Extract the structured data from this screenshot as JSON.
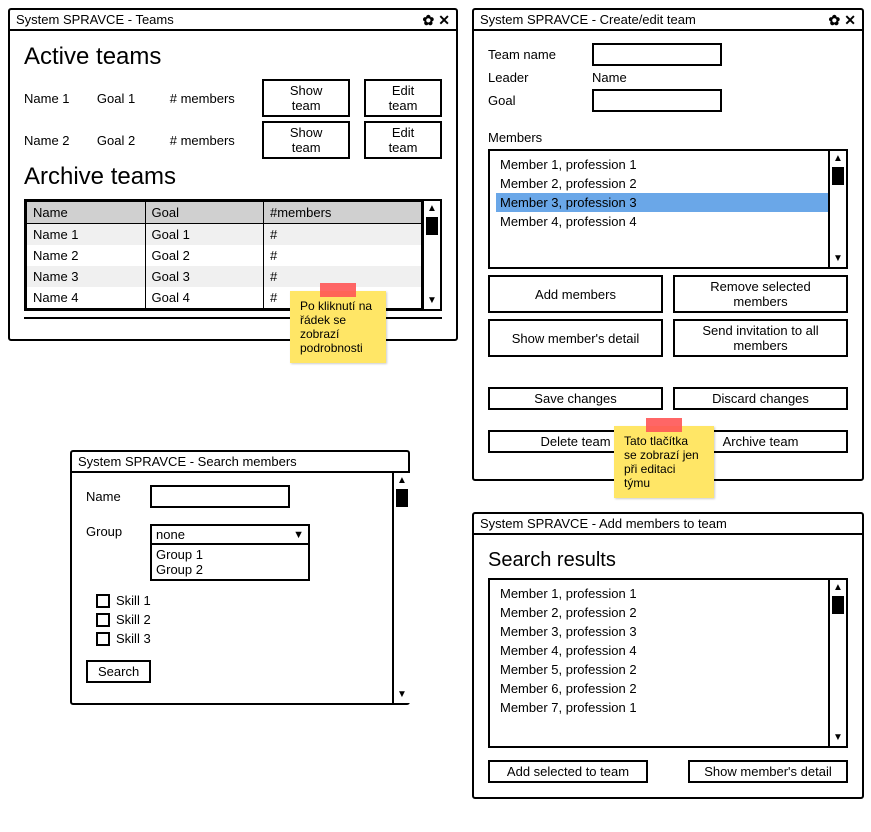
{
  "teams_window": {
    "title": "System SPRAVCE - Teams",
    "heading_active": "Active teams",
    "heading_archive": "Archive teams",
    "active": [
      {
        "name": "Name 1",
        "goal": "Goal 1",
        "members": "# members",
        "show": "Show team",
        "edit": "Edit team"
      },
      {
        "name": "Name 2",
        "goal": "Goal 2",
        "members": "# members",
        "show": "Show team",
        "edit": "Edit team"
      }
    ],
    "cols": {
      "name": "Name",
      "goal": "Goal",
      "members": "#members"
    },
    "archive": [
      {
        "name": "Name 1",
        "goal": "Goal 1",
        "members": "#"
      },
      {
        "name": "Name 2",
        "goal": "Goal 2",
        "members": "#"
      },
      {
        "name": "Name 3",
        "goal": "Goal 3",
        "members": "#"
      },
      {
        "name": "Name 4",
        "goal": "Goal 4",
        "members": "#"
      }
    ],
    "note": "Po kliknutí na řádek se zobrazí podrobnosti"
  },
  "edit_window": {
    "title": "System SPRAVCE - Create/edit team",
    "labels": {
      "team_name": "Team name",
      "leader": "Leader",
      "goal": "Goal",
      "members": "Members"
    },
    "leader_value": "Name",
    "members": [
      "Member 1, profession 1",
      "Member 2, profession 2",
      "Member 3, profession 3",
      "Member 4, profession 4"
    ],
    "buttons": {
      "add": "Add members",
      "remove": "Remove selected members",
      "detail": "Show member's detail",
      "invite": "Send invitation to all members",
      "save": "Save changes",
      "discard": "Discard changes",
      "delete": "Delete team",
      "archive": "Archive team"
    },
    "note": "Tato tlačítka se zobrazí jen při editaci týmu"
  },
  "search_window": {
    "title": "System SPRAVCE - Search members",
    "labels": {
      "name": "Name",
      "group": "Group"
    },
    "group_value": "none",
    "group_options": [
      "Group 1",
      "Group 2"
    ],
    "skills": [
      "Skill 1",
      "Skill 2",
      "Skill 3"
    ],
    "search": "Search"
  },
  "add_window": {
    "title": "System SPRAVCE - Add members to team",
    "heading": "Search results",
    "results": [
      "Member 1, profession 1",
      "Member 2, profession 2",
      "Member 3, profession 3",
      "Member 4, profession 4",
      "Member 5, profession 2",
      "Member 6, profession 2",
      "Member 7, profession 1"
    ],
    "buttons": {
      "add_selected": "Add selected to team",
      "detail": "Show member's detail"
    }
  }
}
